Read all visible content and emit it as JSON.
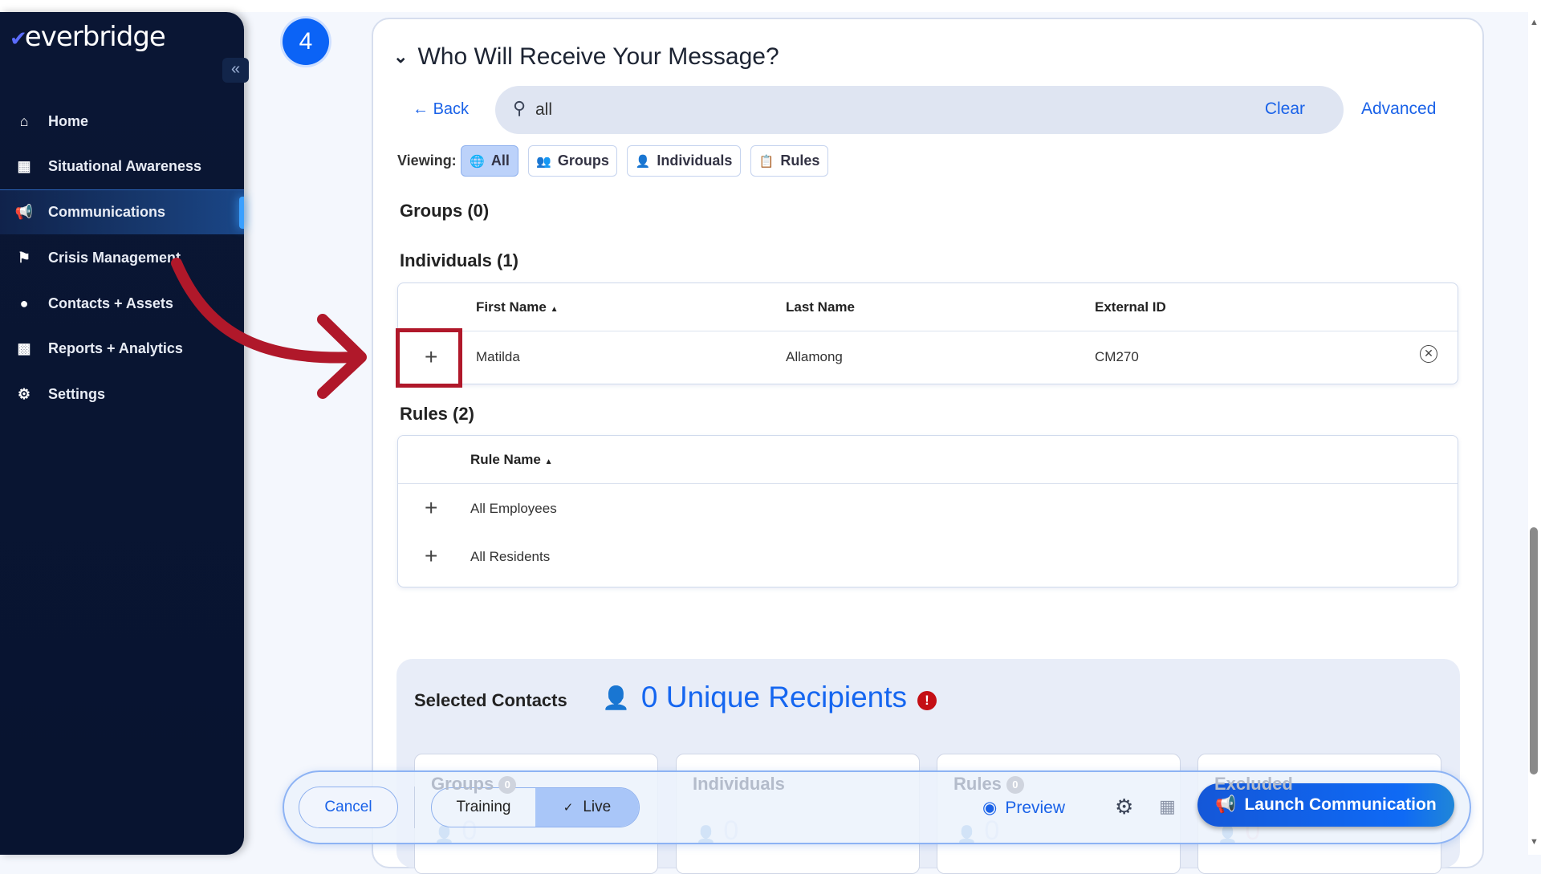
{
  "app": {
    "logo": "everbridge",
    "step_number": "4"
  },
  "sidebar": {
    "collapse_icon": "double-chevron-left",
    "items": [
      {
        "label": "Home",
        "icon": "home-icon"
      },
      {
        "label": "Situational Awareness",
        "icon": "map-icon"
      },
      {
        "label": "Communications",
        "icon": "megaphone-icon",
        "active": true
      },
      {
        "label": "Crisis Management",
        "icon": "crisis-icon"
      },
      {
        "label": "Contacts + Assets",
        "icon": "location-pin-icon"
      },
      {
        "label": "Reports + Analytics",
        "icon": "chart-icon"
      },
      {
        "label": "Settings",
        "icon": "gear-icon"
      }
    ]
  },
  "main": {
    "title": "Who Will Receive Your Message?",
    "back_label": "Back",
    "search": {
      "value": "all",
      "clear_label": "Clear"
    },
    "advanced_label": "Advanced",
    "viewing_label": "Viewing:",
    "filters": [
      {
        "label": "All",
        "active": true
      },
      {
        "label": "Groups"
      },
      {
        "label": "Individuals"
      },
      {
        "label": "Rules"
      }
    ],
    "groups_heading": "Groups (0)",
    "individuals_heading": "Individuals (1)",
    "individuals_table": {
      "columns": [
        "First Name",
        "Last Name",
        "External ID"
      ],
      "sort_indicator": "▲",
      "rows": [
        {
          "first": "Matilda",
          "last": "Allamong",
          "external_id": "CM270"
        }
      ]
    },
    "rules_heading": "Rules (2)",
    "rules_table": {
      "columns": [
        "Rule Name"
      ],
      "rows": [
        "All Employees",
        "All Residents"
      ]
    },
    "selected": {
      "label": "Selected Contacts",
      "count_text": "0 Unique Recipients",
      "warning": "!",
      "cards": [
        {
          "label": "Groups",
          "badge": "0",
          "value": "0"
        },
        {
          "label": "Individuals",
          "value": "0"
        },
        {
          "label": "Rules",
          "badge": "0",
          "value": "0"
        },
        {
          "label": "Excluded",
          "value": "0"
        }
      ]
    }
  },
  "footer": {
    "cancel": "Cancel",
    "training": "Training",
    "live": "Live",
    "live_check": "✓",
    "preview": "Preview",
    "launch": "Launch Communication"
  },
  "colors": {
    "accent": "#1a62e8",
    "sidebar": "#0a1634",
    "annotation": "#b0182a",
    "warning": "#c40f15"
  }
}
